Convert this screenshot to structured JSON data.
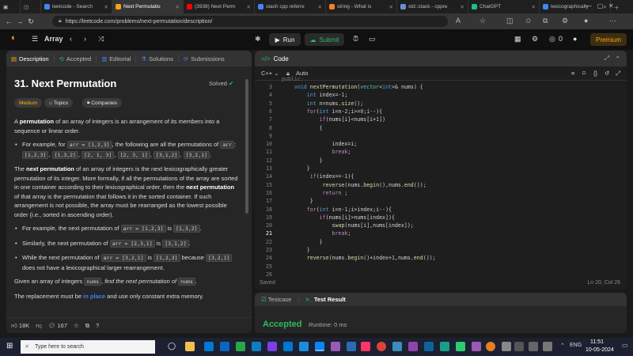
{
  "browser": {
    "tabs": [
      {
        "label": "leetcode - Search",
        "color": "#4285f4"
      },
      {
        "label": "Next Permutatio",
        "color": "#ffa116",
        "active": true
      },
      {
        "label": "(3938) Next Perm",
        "color": "#ff0000"
      },
      {
        "label": "stach cpp referre",
        "color": "#4285f4"
      },
      {
        "label": "string - What is",
        "color": "#f48024"
      },
      {
        "label": "std::stack - cppre",
        "color": "#6a8fd3"
      },
      {
        "label": "ChatGPT",
        "color": "#19c37d"
      },
      {
        "label": "lexicographically",
        "color": "#4285f4"
      }
    ],
    "url": "https://leetcode.com/problems/next-permutation/description/"
  },
  "nav": {
    "problem_list": "Array",
    "run": "Run",
    "submit": "Submit",
    "count": "0",
    "premium": "Premium"
  },
  "left": {
    "tabs": [
      "Description",
      "Accepted",
      "Editorial",
      "Solutions",
      "Submissions"
    ],
    "title": "31. Next Permutation",
    "solved": "Solved",
    "difficulty": "Medium",
    "topics": "Topics",
    "companies": "Companies",
    "likes": "18K",
    "comments": "167"
  },
  "editor": {
    "title": "Code",
    "language": "C++",
    "mode": "Auto",
    "status": "Saved",
    "cursor": "Ln 20, Col 26"
  },
  "test": {
    "tab1": "Testcase",
    "tab2": "Test Result",
    "result": "Accepted",
    "runtime": "Runtime: 0 ms"
  },
  "taskbar": {
    "search_placeholder": "Type here to search",
    "lang": "ENG",
    "time": "11:51",
    "date": "10-05-2024"
  },
  "colors": {
    "accent": "#ffa116",
    "success": "#2cbb5d"
  }
}
